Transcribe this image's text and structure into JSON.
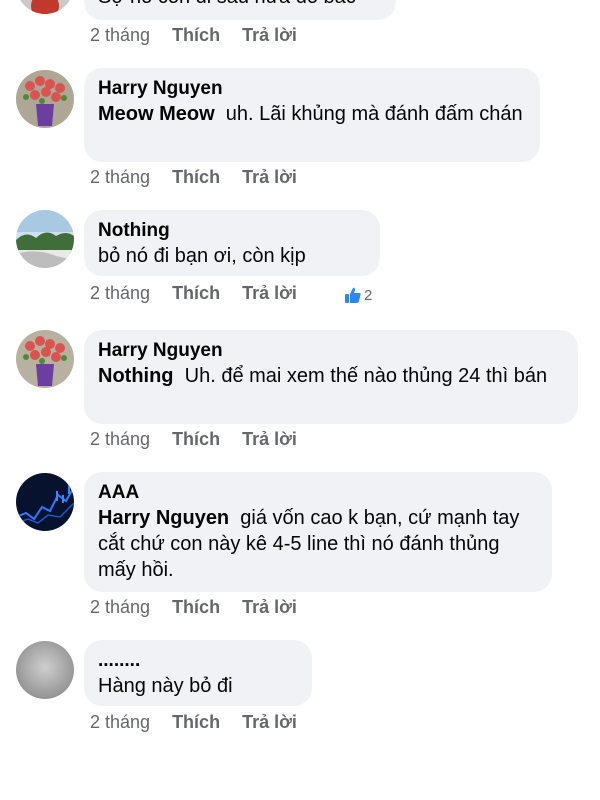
{
  "labels": {
    "like": "Thích",
    "reply": "Trả lời"
  },
  "top_partial": {
    "text": "Sợ nó còn đi sâu nữa đó bác",
    "time": "2 tháng"
  },
  "comments": [
    {
      "author": "Harry Nguyen",
      "mention": "Meow Meow",
      "text": "uh. Lãi khủng mà đánh đấm chán",
      "time": "2 tháng",
      "avatar": "flowers-vase-avatar"
    },
    {
      "author": "Nothing",
      "mention": "",
      "text": "bỏ nó đi bạn ơi, còn kịp",
      "time": "2 tháng",
      "avatar": "landscape-avatar",
      "reaction_count": "2"
    },
    {
      "author": "Harry Nguyen",
      "mention": "Nothing",
      "text": "Uh. để mai xem thế nào thủng 24 thì bán",
      "time": "2 tháng",
      "avatar": "flowers-vase-avatar"
    },
    {
      "author": "AAA",
      "mention": "Harry Nguyen",
      "text": "giá vốn cao k bạn, cứ mạnh tay cắt chứ con này kê 4-5 line thì nó đánh thủng mấy hồi.",
      "time": "2 tháng",
      "avatar": "stock-chart-avatar"
    },
    {
      "author": "........",
      "mention": "",
      "text": "Hàng này bỏ đi",
      "time": "2 tháng",
      "avatar": "gray-blur-avatar"
    }
  ]
}
